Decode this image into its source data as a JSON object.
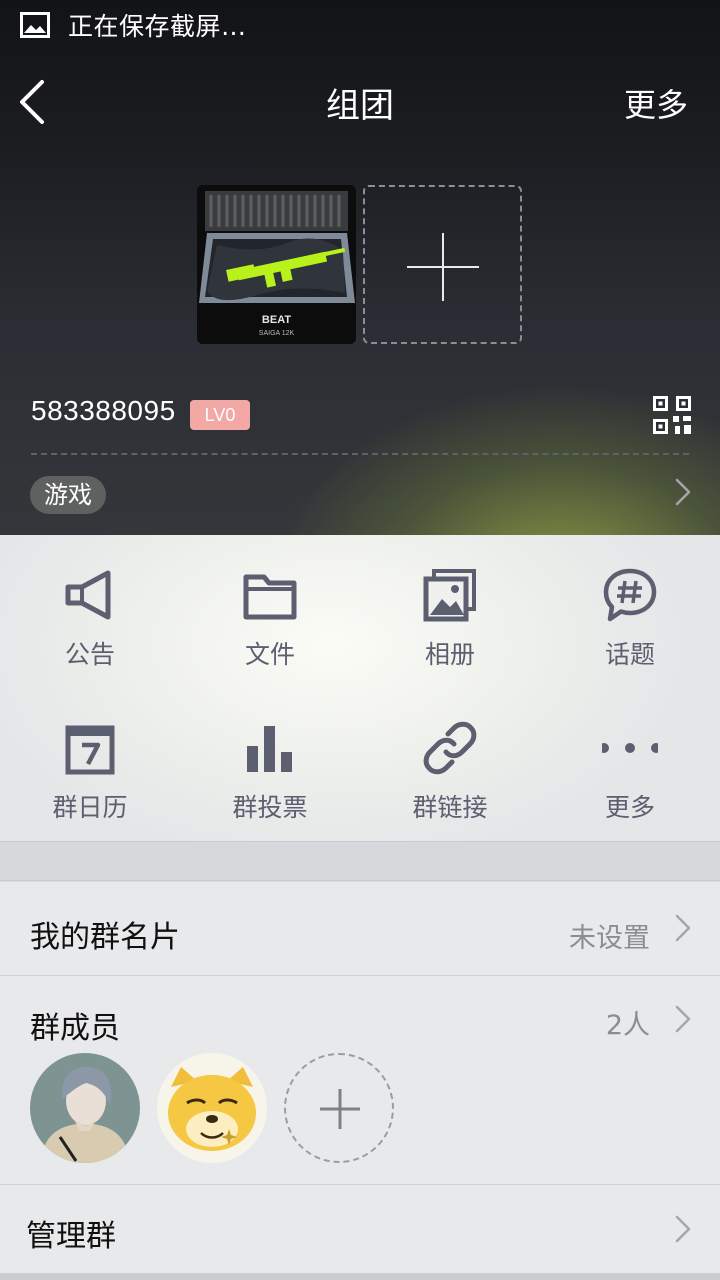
{
  "status_bar": {
    "text": "正在保存截屏…",
    "icon": "image-icon"
  },
  "nav": {
    "title": "组团",
    "more_label": "更多",
    "back_icon": "chevron-left-icon"
  },
  "group": {
    "avatar_caption_title": "BEAT",
    "avatar_caption_sub": "SAIGA 12K",
    "id": "583388095",
    "level": "LV0",
    "tag": "游戏"
  },
  "features": [
    {
      "label": "公告",
      "icon": "megaphone-icon"
    },
    {
      "label": "文件",
      "icon": "folder-icon"
    },
    {
      "label": "相册",
      "icon": "album-icon"
    },
    {
      "label": "话题",
      "icon": "hashtag-bubble-icon"
    },
    {
      "label": "群日历",
      "icon": "calendar-icon"
    },
    {
      "label": "群投票",
      "icon": "bar-chart-icon"
    },
    {
      "label": "群链接",
      "icon": "link-icon"
    },
    {
      "label": "更多",
      "icon": "more-dots-icon"
    }
  ],
  "my_card": {
    "title": "我的群名片",
    "value": "未设置"
  },
  "members": {
    "title": "群成员",
    "count": "2人"
  },
  "manage": {
    "title": "管理群"
  },
  "colors": {
    "icon": "#5b5f70",
    "badge": "#f2a9a6",
    "accent_glow": "#96aa46"
  }
}
